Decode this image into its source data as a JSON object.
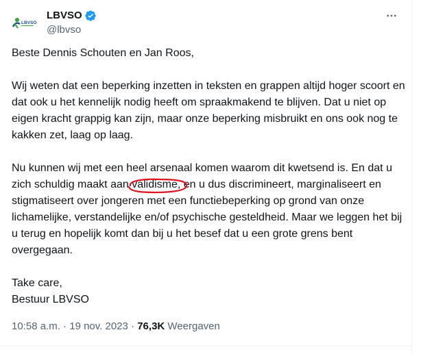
{
  "account": {
    "display_name": "LBVSO",
    "handle": "@lbvso",
    "avatar_text": "LBVSO"
  },
  "tweet": {
    "greeting": "Beste Dennis Schouten en Jan Roos,",
    "paragraph1": "Wij weten dat een beperking inzetten in teksten en grappen altijd hoger scoort en dat ook u het kennelijk nodig heeft om spraakmakend te blijven. Dat u niet op eigen kracht grappig kan zijn, maar onze beperking misbruikt en ons ook nog te kakken zet, laag op laag.",
    "paragraph2_before": "Nu kunnen wij met een heel arsenaal komen waarom dit kwetsend is. En dat u zich schuldig maakt aan ",
    "paragraph2_circled": "validisme",
    "paragraph2_after": ", en u dus discrimineert, marginaliseert en stigmatiseert over jongeren met een functiebeperking op grond van onze lichamelijke, verstandelijke en/of psychische gesteldheid. Maar we leggen het bij u terug en hopelijk komt dan bij u het besef dat u een grote grens bent overgegaan.",
    "closing1": "Take care,",
    "closing2": "Bestuur LBVSO"
  },
  "meta": {
    "time": "10:58 a.m.",
    "separator1": " · ",
    "date": "19 nov. 2023",
    "separator2": " · ",
    "views_count": "76,3K",
    "views_label": "Weergaven"
  },
  "colors": {
    "text": "#0f1419",
    "secondary": "#536471",
    "verified": "#1d9bf0",
    "highlight_circle": "#e0141e",
    "logo_green": "#3aa63a",
    "logo_blue": "#1d4f91"
  }
}
